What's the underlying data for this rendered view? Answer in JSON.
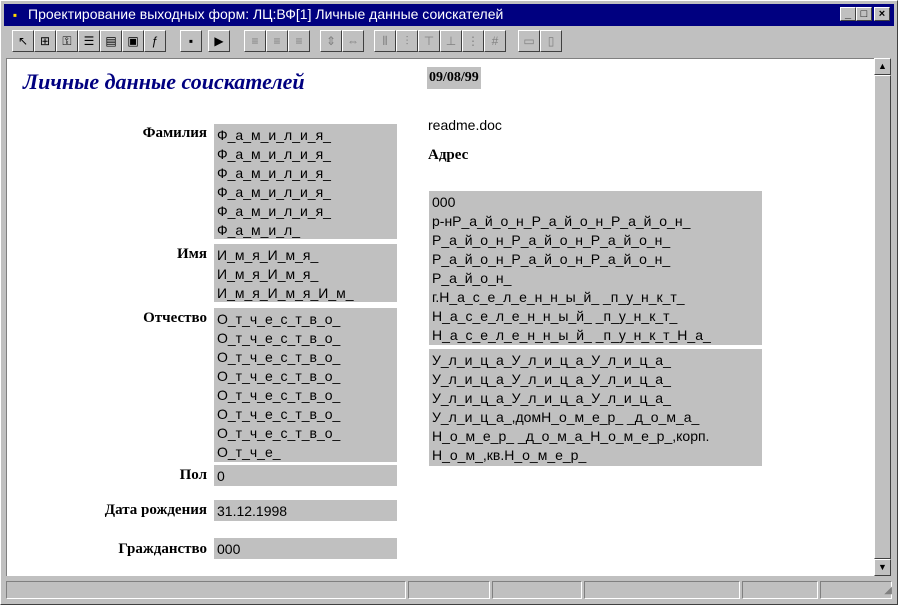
{
  "window": {
    "title": "Проектирование выходных форм: ЛЦ:ВФ[1] Личные данные соискателей",
    "minimize": "_",
    "maximize": "□",
    "close": "×"
  },
  "form": {
    "title": "Личные данные соискателей",
    "date": "09/08/99",
    "file": "readme.doc",
    "address_label": "Адрес",
    "fields": {
      "surname": {
        "label": "Фамилия",
        "value": "Ф_а_м_и_л_и_я_\nФ_а_м_и_л_и_я_\nФ_а_м_и_л_и_я_\nФ_а_м_и_л_и_я_\nФ_а_м_и_л_и_я_\nФ_а_м_и_л_"
      },
      "name": {
        "label": "Имя",
        "value": "И_м_я_И_м_я_\nИ_м_я_И_м_я_\nИ_м_я_И_м_я_И_м_"
      },
      "patronymic": {
        "label": "Отчество",
        "value": "О_т_ч_е_с_т_в_о_\nО_т_ч_е_с_т_в_о_\nО_т_ч_е_с_т_в_о_\nО_т_ч_е_с_т_в_о_\nО_т_ч_е_с_т_в_о_\nО_т_ч_е_с_т_в_о_\nО_т_ч_е_с_т_в_о_\nО_т_ч_е_"
      },
      "sex": {
        "label": "Пол",
        "value": "0"
      },
      "birthdate": {
        "label": "Дата рождения",
        "value": "31.12.1998"
      },
      "citizenship": {
        "label": "Гражданство",
        "value": "000"
      }
    },
    "address_block1": "000\nр-нР_а_й_о_н_Р_а_й_о_н_Р_а_й_о_н_\nР_а_й_о_н_Р_а_й_о_н_Р_а_й_о_н_\nР_а_й_о_н_Р_а_й_о_н_Р_а_й_о_н_\nР_а_й_о_н_\nг.Н_а_с_е_л_е_н_н_ы_й_ _п_у_н_к_т_\nН_а_с_е_л_е_н_н_ы_й_ _п_у_н_к_т_\nН_а_с_е_л_е_н_н_ы_й_ _п_у_н_к_т_Н_а_",
    "address_block2": "У_л_и_ц_а_У_л_и_ц_а_У_л_и_ц_а_\nУ_л_и_ц_а_У_л_и_ц_а_У_л_и_ц_а_\nУ_л_и_ц_а_У_л_и_ц_а_У_л_и_ц_а_\nУ_л_и_ц_а_,домН_о_м_е_р_ _д_о_м_а_\nН_о_м_е_р_ _д_о_м_а_Н_о_м_е_р_,корп.\nН_о_м_,кв.Н_о_м_е_р_"
  },
  "toolbar": {
    "tools": [
      "pointer-tool-icon",
      "frame-tool-icon",
      "key-field-icon",
      "list-icon",
      "text-block-icon",
      "image-icon",
      "formula-icon",
      "save-icon",
      "run-icon",
      "align-left-icon",
      "align-center-icon",
      "align-right-icon",
      "same-height-icon",
      "same-width-icon",
      "space-h-icon",
      "space-v-icon",
      "align-top-icon",
      "align-bottom-icon",
      "distribute-icon",
      "grid-icon",
      "field-icon",
      "page-icon"
    ]
  },
  "scrollbar": {
    "up": "▲",
    "down": "▼"
  },
  "colors": {
    "title_bar": "#000080",
    "field_bg": "#c0c0c0",
    "form_title": "#000080"
  }
}
